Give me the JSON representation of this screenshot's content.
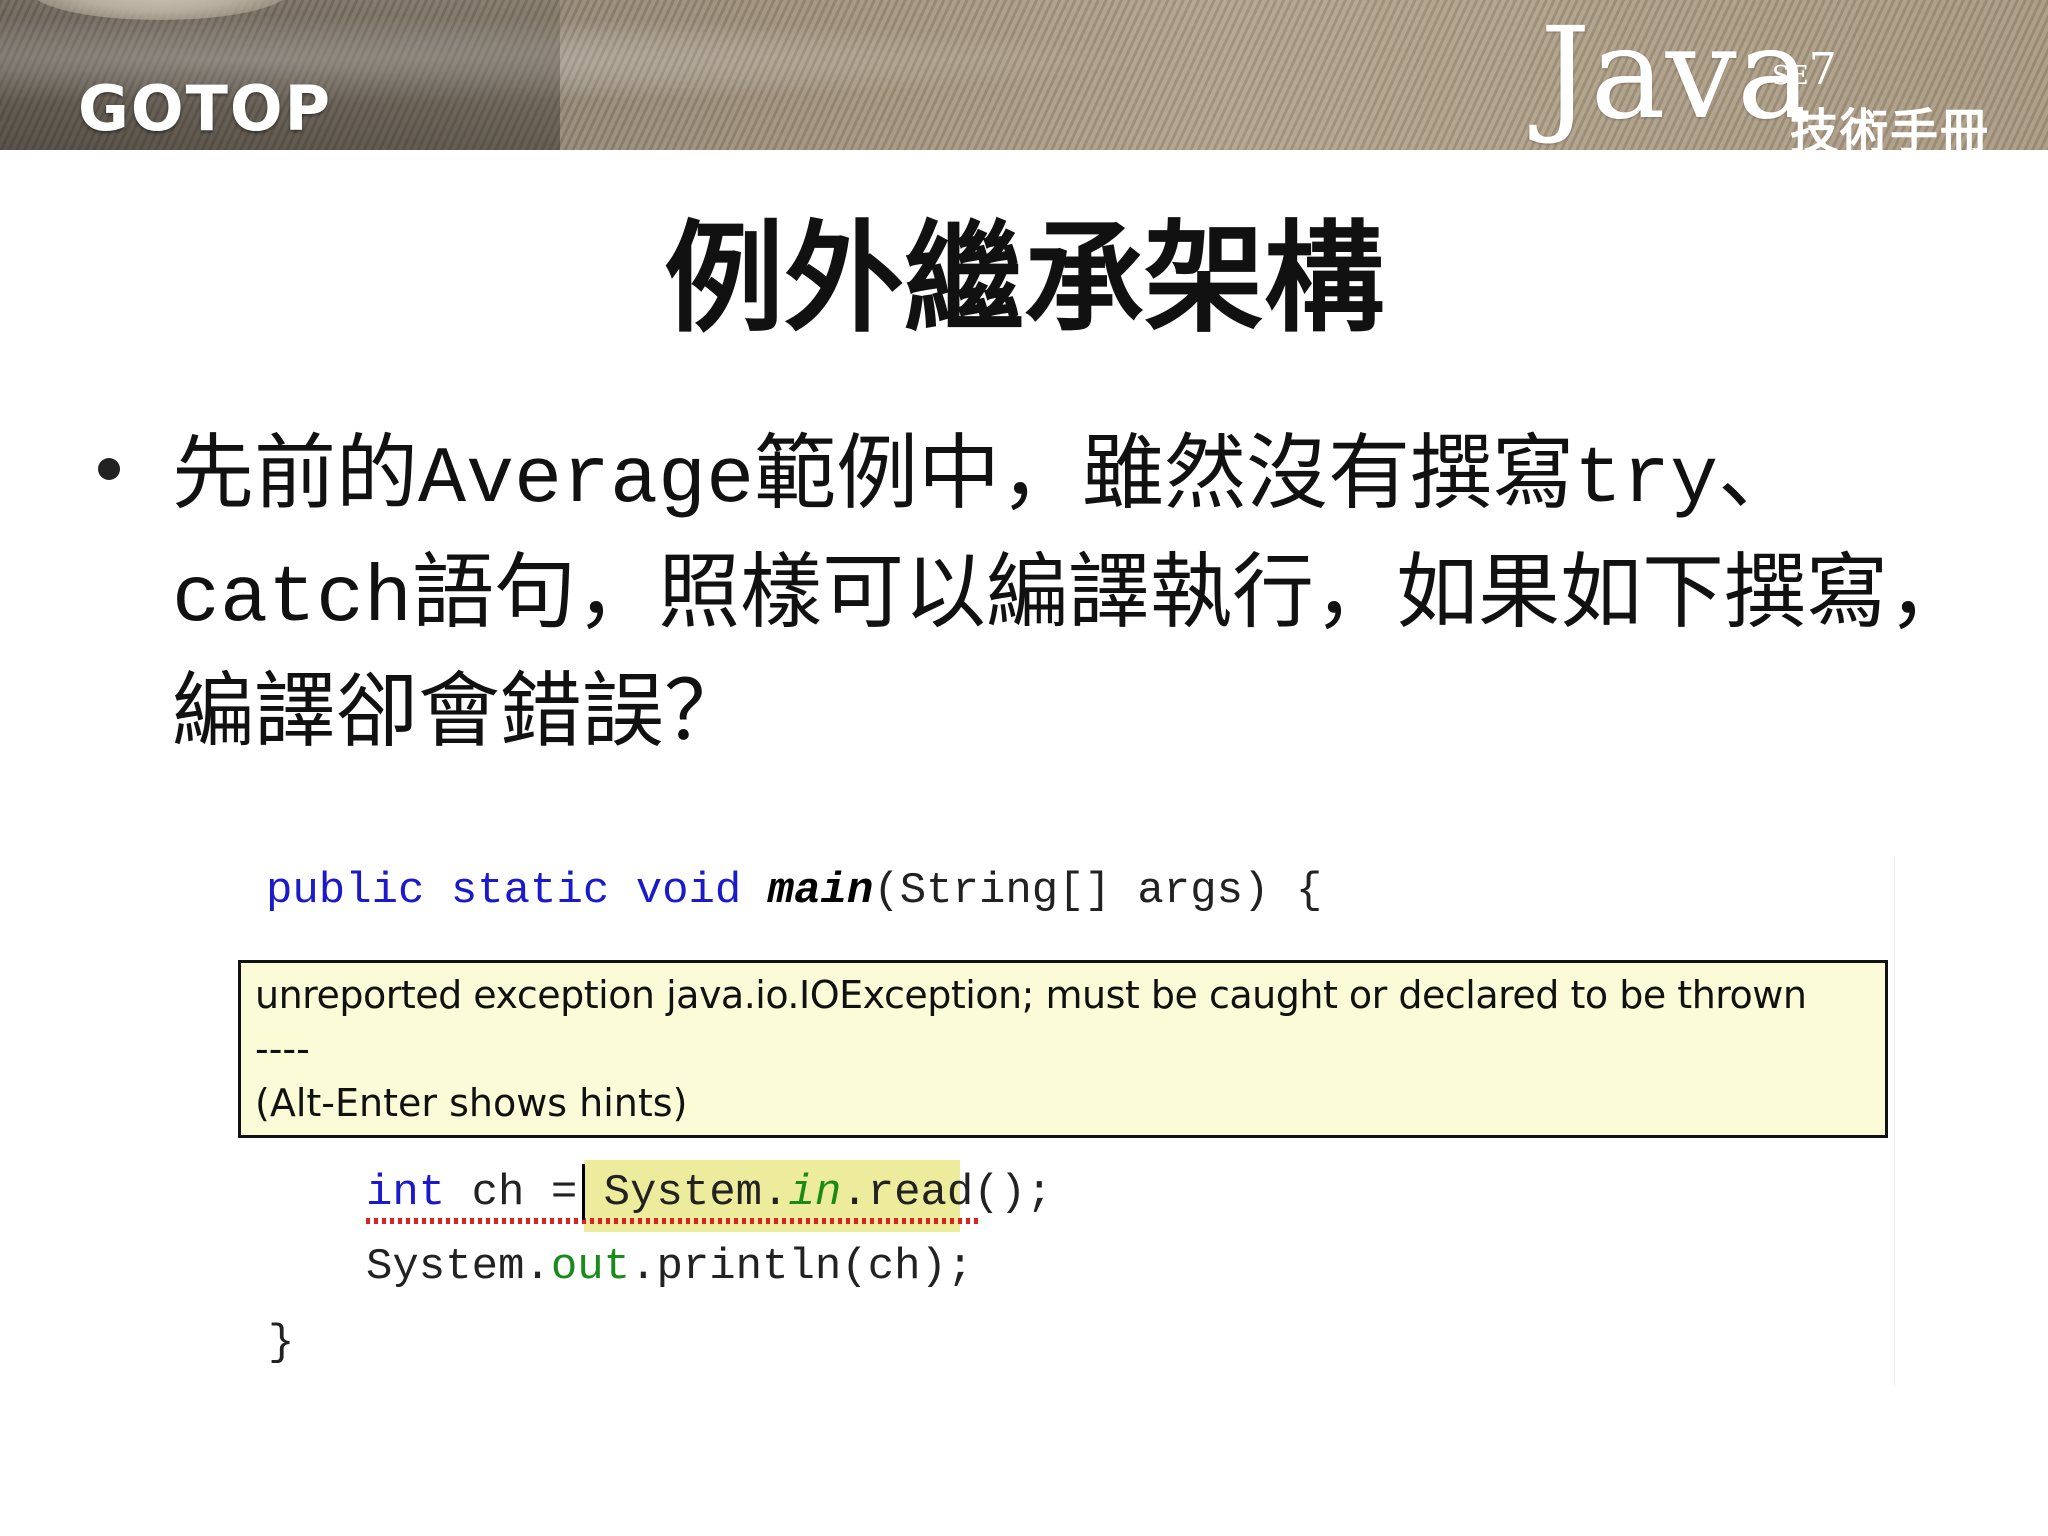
{
  "header": {
    "publisher_logo": "GOTOP",
    "book_logo": {
      "java": "Java",
      "edition_se": "SE",
      "edition_num": "7",
      "subtitle": "技術手冊"
    }
  },
  "slide": {
    "title": "例外繼承架構",
    "bullet": {
      "part1": "先前的",
      "code1": "Average",
      "part2": "範例中，雖然沒有撰寫",
      "code2": "try",
      "part3": "、",
      "code3": "catch",
      "part4": "語句，照樣可以編譯執行，如果如下撰寫，編譯卻會錯誤？"
    }
  },
  "code": {
    "line1": {
      "kw1": "public",
      "kw2": "static",
      "kw3": "void",
      "method": "main",
      "rest": "(String[] args) {"
    },
    "line3": {
      "kw": "int",
      "before": " ch = ",
      "cls": "System.",
      "field": "in",
      "call": ".read()",
      "end": ";"
    },
    "line4": {
      "cls": "System.",
      "field": "out",
      "call": ".println(ch);"
    },
    "line5": "}"
  },
  "tooltip": {
    "message": "unreported exception java.io.IOException; must be caught or declared to be thrown",
    "separator": "----",
    "hint": "(Alt-Enter shows hints)"
  },
  "colors": {
    "keyword": "#1a1acc",
    "field": "#1a8a1a",
    "tooltip_bg": "#fbfbd8",
    "highlight": "#ecec9c",
    "error_underline": "#e02020"
  }
}
